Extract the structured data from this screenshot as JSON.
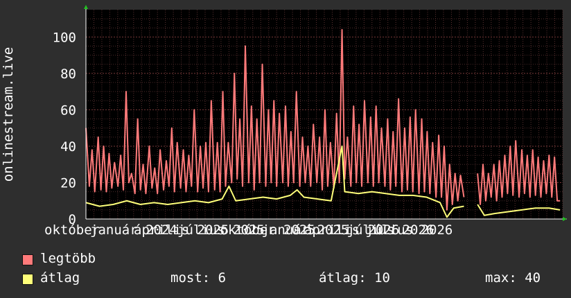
{
  "chart_data": {
    "type": "line",
    "ylabel": "onlinestream.live",
    "yticks": [
      0,
      20,
      40,
      60,
      80,
      100
    ],
    "ylim": [
      0,
      115
    ],
    "xlim": [
      0,
      1
    ],
    "xtick_labels": [
      {
        "label": "október",
        "pos": 0.0
      },
      {
        "label": "január 2024",
        "pos": 0.088
      },
      {
        "label": "április 2025",
        "pos": 0.172
      },
      {
        "label": "július 2025",
        "pos": 0.256
      },
      {
        "label": "október 2025",
        "pos": 0.338
      },
      {
        "label": "január 2025",
        "pos": 0.418
      },
      {
        "label": "április 2026",
        "pos": 0.5
      },
      {
        "label": "július 2026",
        "pos": 0.582
      },
      {
        "label": "július 2026",
        "pos": 0.618
      }
    ],
    "grid": true,
    "series": [
      {
        "name": "legtöbb",
        "color": "#ff7a7a",
        "points": [
          [
            0,
            50
          ],
          [
            0.005,
            18
          ],
          [
            0.009,
            38
          ],
          [
            0.013,
            15
          ],
          [
            0.018,
            45
          ],
          [
            0.022,
            16
          ],
          [
            0.026,
            40
          ],
          [
            0.03,
            15
          ],
          [
            0.034,
            36
          ],
          [
            0.038,
            17
          ],
          [
            0.042,
            31
          ],
          [
            0.047,
            18
          ],
          [
            0.051,
            35
          ],
          [
            0.055,
            16
          ],
          [
            0.059,
            70
          ],
          [
            0.063,
            20
          ],
          [
            0.067,
            25
          ],
          [
            0.072,
            14
          ],
          [
            0.076,
            55
          ],
          [
            0.08,
            16
          ],
          [
            0.084,
            30
          ],
          [
            0.088,
            14
          ],
          [
            0.093,
            40
          ],
          [
            0.097,
            17
          ],
          [
            0.101,
            28
          ],
          [
            0.105,
            14
          ],
          [
            0.109,
            38
          ],
          [
            0.114,
            16
          ],
          [
            0.118,
            32
          ],
          [
            0.122,
            18
          ],
          [
            0.126,
            50
          ],
          [
            0.13,
            15
          ],
          [
            0.134,
            42
          ],
          [
            0.139,
            17
          ],
          [
            0.143,
            38
          ],
          [
            0.147,
            15
          ],
          [
            0.151,
            35
          ],
          [
            0.155,
            18
          ],
          [
            0.159,
            60
          ],
          [
            0.164,
            15
          ],
          [
            0.168,
            40
          ],
          [
            0.172,
            17
          ],
          [
            0.176,
            42
          ],
          [
            0.18,
            15
          ],
          [
            0.184,
            65
          ],
          [
            0.189,
            16
          ],
          [
            0.193,
            42
          ],
          [
            0.197,
            15
          ],
          [
            0.201,
            70
          ],
          [
            0.205,
            18
          ],
          [
            0.209,
            42
          ],
          [
            0.214,
            20
          ],
          [
            0.218,
            80
          ],
          [
            0.222,
            22
          ],
          [
            0.226,
            55
          ],
          [
            0.23,
            18
          ],
          [
            0.234,
            95
          ],
          [
            0.239,
            20
          ],
          [
            0.243,
            62
          ],
          [
            0.247,
            16
          ],
          [
            0.251,
            55
          ],
          [
            0.255,
            20
          ],
          [
            0.259,
            85
          ],
          [
            0.264,
            18
          ],
          [
            0.268,
            60
          ],
          [
            0.272,
            20
          ],
          [
            0.276,
            65
          ],
          [
            0.28,
            18
          ],
          [
            0.284,
            58
          ],
          [
            0.289,
            20
          ],
          [
            0.293,
            62
          ],
          [
            0.297,
            18
          ],
          [
            0.301,
            48
          ],
          [
            0.305,
            20
          ],
          [
            0.309,
            70
          ],
          [
            0.314,
            18
          ],
          [
            0.318,
            45
          ],
          [
            0.322,
            20
          ],
          [
            0.326,
            40
          ],
          [
            0.33,
            18
          ],
          [
            0.334,
            52
          ],
          [
            0.339,
            20
          ],
          [
            0.343,
            45
          ],
          [
            0.347,
            16
          ],
          [
            0.351,
            60
          ],
          [
            0.355,
            18
          ],
          [
            0.359,
            42
          ],
          [
            0.364,
            17
          ],
          [
            0.368,
            58
          ],
          [
            0.372,
            20
          ],
          [
            0.376,
            104
          ],
          [
            0.38,
            22
          ],
          [
            0.384,
            45
          ],
          [
            0.389,
            18
          ],
          [
            0.393,
            62
          ],
          [
            0.397,
            20
          ],
          [
            0.401,
            52
          ],
          [
            0.405,
            18
          ],
          [
            0.409,
            65
          ],
          [
            0.414,
            20
          ],
          [
            0.418,
            56
          ],
          [
            0.422,
            18
          ],
          [
            0.426,
            62
          ],
          [
            0.43,
            20
          ],
          [
            0.434,
            50
          ],
          [
            0.439,
            18
          ],
          [
            0.443,
            55
          ],
          [
            0.447,
            16
          ],
          [
            0.451,
            48
          ],
          [
            0.455,
            18
          ],
          [
            0.459,
            66
          ],
          [
            0.464,
            15
          ],
          [
            0.468,
            50
          ],
          [
            0.472,
            16
          ],
          [
            0.476,
            56
          ],
          [
            0.48,
            15
          ],
          [
            0.484,
            60
          ],
          [
            0.489,
            14
          ],
          [
            0.493,
            55
          ],
          [
            0.497,
            15
          ],
          [
            0.501,
            48
          ],
          [
            0.505,
            14
          ],
          [
            0.509,
            42
          ],
          [
            0.514,
            12
          ],
          [
            0.518,
            46
          ],
          [
            0.522,
            12
          ],
          [
            0.526,
            40
          ],
          [
            0.53,
            5
          ],
          [
            0.534,
            30
          ],
          [
            0.538,
            8
          ],
          [
            0.542,
            25
          ],
          [
            0.546,
            10
          ],
          [
            0.55,
            24
          ],
          [
            0.555,
            12
          ],
          [
            null,
            null
          ],
          [
            0.575,
            25
          ],
          [
            0.579,
            8
          ],
          [
            0.583,
            30
          ],
          [
            0.587,
            10
          ],
          [
            0.591,
            25
          ],
          [
            0.595,
            12
          ],
          [
            0.599,
            30
          ],
          [
            0.603,
            10
          ],
          [
            0.607,
            32
          ],
          [
            0.611,
            12
          ],
          [
            0.615,
            35
          ],
          [
            0.619,
            14
          ],
          [
            0.623,
            40
          ],
          [
            0.627,
            13
          ],
          [
            0.631,
            43
          ],
          [
            0.636,
            12
          ],
          [
            0.64,
            38
          ],
          [
            0.644,
            14
          ],
          [
            0.648,
            35
          ],
          [
            0.652,
            12
          ],
          [
            0.656,
            38
          ],
          [
            0.66,
            13
          ],
          [
            0.664,
            34
          ],
          [
            0.668,
            12
          ],
          [
            0.672,
            32
          ],
          [
            0.676,
            14
          ],
          [
            0.68,
            35
          ],
          [
            0.684,
            12
          ],
          [
            0.688,
            34
          ],
          [
            0.692,
            10
          ],
          [
            0.696,
            10
          ]
        ]
      },
      {
        "name": "átlag",
        "color": "#ffff7a",
        "points": [
          [
            0,
            9
          ],
          [
            0.02,
            7
          ],
          [
            0.04,
            8
          ],
          [
            0.06,
            10
          ],
          [
            0.08,
            8
          ],
          [
            0.1,
            9
          ],
          [
            0.12,
            8
          ],
          [
            0.14,
            9
          ],
          [
            0.16,
            10
          ],
          [
            0.18,
            9
          ],
          [
            0.2,
            11
          ],
          [
            0.21,
            18
          ],
          [
            0.22,
            10
          ],
          [
            0.24,
            11
          ],
          [
            0.26,
            12
          ],
          [
            0.28,
            11
          ],
          [
            0.3,
            13
          ],
          [
            0.31,
            16
          ],
          [
            0.32,
            12
          ],
          [
            0.34,
            11
          ],
          [
            0.36,
            10
          ],
          [
            0.376,
            40
          ],
          [
            0.38,
            15
          ],
          [
            0.4,
            14
          ],
          [
            0.42,
            15
          ],
          [
            0.44,
            14
          ],
          [
            0.46,
            13
          ],
          [
            0.48,
            13
          ],
          [
            0.5,
            12
          ],
          [
            0.52,
            9
          ],
          [
            0.53,
            1
          ],
          [
            0.54,
            6
          ],
          [
            0.555,
            7
          ],
          [
            null,
            null
          ],
          [
            0.575,
            8
          ],
          [
            0.585,
            2
          ],
          [
            0.6,
            3
          ],
          [
            0.62,
            4
          ],
          [
            0.64,
            5
          ],
          [
            0.66,
            6
          ],
          [
            0.68,
            6
          ],
          [
            0.696,
            5
          ]
        ]
      }
    ]
  },
  "legend": {
    "items": [
      {
        "label": "legtöbb",
        "color": "#ff7a7a"
      },
      {
        "label": "átlag",
        "color": "#ffff7a"
      }
    ],
    "stats": {
      "now": "most: 6",
      "avg": "átlag: 10",
      "max": "max: 40"
    }
  }
}
